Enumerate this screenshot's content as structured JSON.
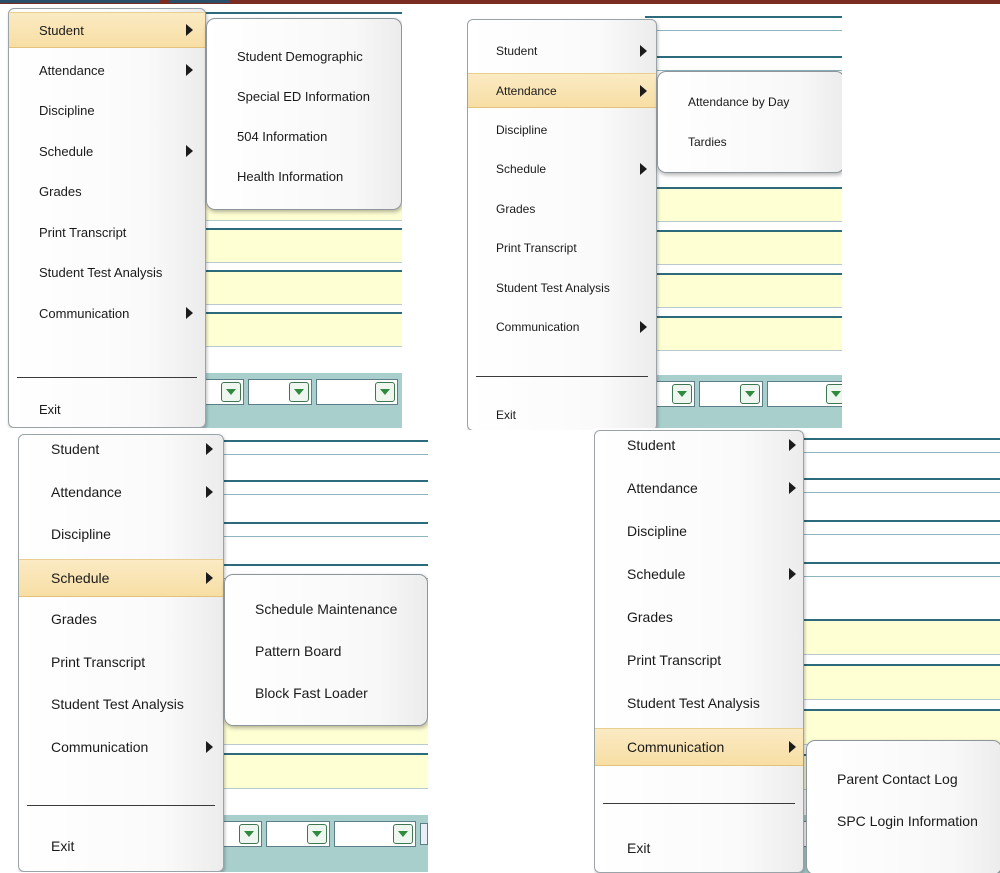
{
  "menu_items": [
    {
      "label": "Student",
      "has_submenu": true
    },
    {
      "label": "Attendance",
      "has_submenu": true
    },
    {
      "label": "Discipline",
      "has_submenu": false
    },
    {
      "label": "Schedule",
      "has_submenu": true
    },
    {
      "label": "Grades",
      "has_submenu": false
    },
    {
      "label": "Print Transcript",
      "has_submenu": false
    },
    {
      "label": "Student Test Analysis",
      "has_submenu": false
    },
    {
      "label": "Communication",
      "has_submenu": true
    }
  ],
  "exit_label": "Exit",
  "submenus": {
    "student": [
      "Student Demographic",
      "Special ED Information",
      "504 Information",
      "Health Information"
    ],
    "attendance": [
      "Attendance by Day",
      "Tardies"
    ],
    "schedule": [
      "Schedule Maintenance",
      "Pattern Board",
      "Block Fast Loader"
    ],
    "communication": [
      "Parent Contact Log",
      "SPC Login Information"
    ]
  },
  "panels": [
    {
      "name": "student-menu-panel",
      "active_index": 0,
      "submenu_key": "student"
    },
    {
      "name": "attendance-menu-panel",
      "active_index": 1,
      "submenu_key": "attendance"
    },
    {
      "name": "schedule-menu-panel",
      "active_index": 3,
      "submenu_key": "schedule"
    },
    {
      "name": "communication-menu-panel",
      "active_index": 7,
      "submenu_key": "communication"
    }
  ],
  "colors": {
    "highlight": "#f7dea4",
    "form_field_yellow": "#ffffd4",
    "form_line_teal": "#2c6b7b",
    "top_strip": "#7a2b22"
  }
}
